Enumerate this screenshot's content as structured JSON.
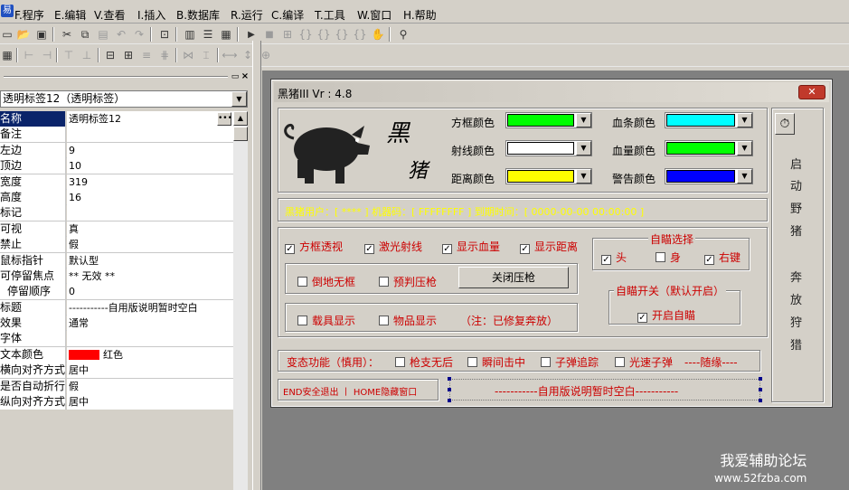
{
  "menu": [
    {
      "key": "F",
      "label": "F.程序"
    },
    {
      "key": "E",
      "label": "E.编辑"
    },
    {
      "key": "V",
      "label": "V.查看"
    },
    {
      "key": "I",
      "label": "I.插入"
    },
    {
      "key": "B",
      "label": "B.数据库"
    },
    {
      "key": "R",
      "label": "R.运行"
    },
    {
      "key": "C",
      "label": "C.编译"
    },
    {
      "key": "T",
      "label": "T.工具"
    },
    {
      "key": "W",
      "label": "W.窗口"
    },
    {
      "key": "H",
      "label": "H.帮助"
    }
  ],
  "object_selector": "透明标签12（透明标签）",
  "properties": [
    {
      "name": "名称",
      "value": "透明标签12"
    },
    {
      "name": "备注",
      "value": ""
    },
    {
      "name": "左边",
      "value": "9"
    },
    {
      "name": "顶边",
      "value": "10"
    },
    {
      "name": "宽度",
      "value": "319"
    },
    {
      "name": "高度",
      "value": "16"
    },
    {
      "name": "标记",
      "value": ""
    },
    {
      "name": "可视",
      "value": "真"
    },
    {
      "name": "禁止",
      "value": "假"
    },
    {
      "name": "鼠标指针",
      "value": "默认型"
    },
    {
      "name": "可停留焦点",
      "value": "** 无效 **"
    },
    {
      "name": "停留顺序",
      "value": "0"
    },
    {
      "name": "标题",
      "value": "-----------自用版说明暂时空白"
    },
    {
      "name": "效果",
      "value": "通常"
    },
    {
      "name": "字体",
      "value": ""
    },
    {
      "name": "文本颜色",
      "value": "红色"
    },
    {
      "name": "横向对齐方式",
      "value": "居中"
    },
    {
      "name": "是否自动折行",
      "value": "假"
    },
    {
      "name": "纵向对齐方式",
      "value": "居中"
    }
  ],
  "form": {
    "title": "黑猪III Vr : 4.8",
    "logo_text": [
      "黑",
      "猪"
    ],
    "colors": {
      "box_color": {
        "label": "方框颜色",
        "hex": "#00ff00"
      },
      "ray_color": {
        "label": "射线颜色",
        "hex": "#ffffff"
      },
      "dist_color": {
        "label": "距离颜色",
        "hex": "#ffff00"
      },
      "hp_bar_color": {
        "label": "血条颜色",
        "hex": "#00ffff"
      },
      "hp_amount_color": {
        "label": "血量颜色",
        "hex": "#00ff00"
      },
      "warn_color": {
        "label": "警告颜色",
        "hex": "#0000ff"
      }
    },
    "user_info": "黑猪用户：[    ****    ] 机器码：[  FFFFFFFF  ] 到期时间：[  0000-00-00 00:00:00  ]",
    "options_row1": [
      {
        "label": "方框透视",
        "checked": true
      },
      {
        "label": "激光射线",
        "checked": true
      },
      {
        "label": "显示血量",
        "checked": true
      },
      {
        "label": "显示距离",
        "checked": true
      }
    ],
    "opt_no_ground": {
      "label": "倒地无框",
      "checked": false
    },
    "opt_predict": {
      "label": "预判压枪",
      "checked": false
    },
    "close_recoil_btn": "关闭压枪",
    "opt_vehicle": {
      "label": "载具显示",
      "checked": false
    },
    "opt_items": {
      "label": "物品显示",
      "checked": false
    },
    "fixed_note": "（注：已修复奔放）",
    "aim_select": {
      "title": "自瞄选择",
      "head": {
        "label": "头",
        "checked": true
      },
      "body": {
        "label": "身",
        "checked": false
      },
      "rbtn": {
        "label": "右键",
        "checked": true
      }
    },
    "aim_switch": {
      "title": "自瞄开关（默认开启）",
      "enable": {
        "label": "开启自瞄",
        "checked": true
      }
    },
    "start_label": [
      "启",
      "动",
      "野",
      "猪"
    ],
    "fun_label": [
      "奔",
      "放",
      "狩",
      "猎"
    ],
    "dynamic_label": "变态功能（慎用）：",
    "dynamic_opts": [
      {
        "label": "枪支无后",
        "checked": false
      },
      {
        "label": "瞬间击中",
        "checked": false
      },
      {
        "label": "子弹追踪",
        "checked": false
      },
      {
        "label": "光速子弹",
        "checked": false
      }
    ],
    "dynamic_tail": "----随缘----",
    "hotkey_note": "END安全退出 丨 HOME隐藏窗口",
    "selected_label": "-----------自用版说明暂时空白-----------"
  },
  "watermark": {
    "line1": "我爱辅助论坛",
    "line2": "www.52fzba.com"
  }
}
